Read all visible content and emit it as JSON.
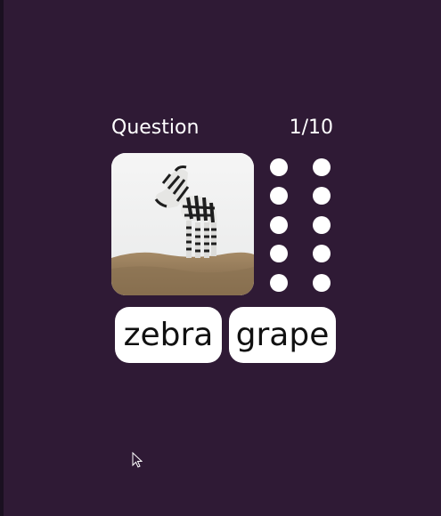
{
  "header": {
    "label": "Question",
    "progress": "1/10"
  },
  "question": {
    "image_icon": "zebra-image",
    "progress_dots": [
      {
        "state": "pending"
      },
      {
        "state": "pending"
      },
      {
        "state": "pending"
      },
      {
        "state": "pending"
      },
      {
        "state": "pending"
      },
      {
        "state": "pending"
      },
      {
        "state": "pending"
      },
      {
        "state": "pending"
      },
      {
        "state": "pending"
      },
      {
        "state": "pending"
      }
    ]
  },
  "answers": [
    {
      "label": "zebra"
    },
    {
      "label": "grape"
    }
  ],
  "colors": {
    "background": "#2f1a35",
    "button": "#ffffff",
    "text_light": "#ffffff",
    "text_dark": "#111111"
  }
}
